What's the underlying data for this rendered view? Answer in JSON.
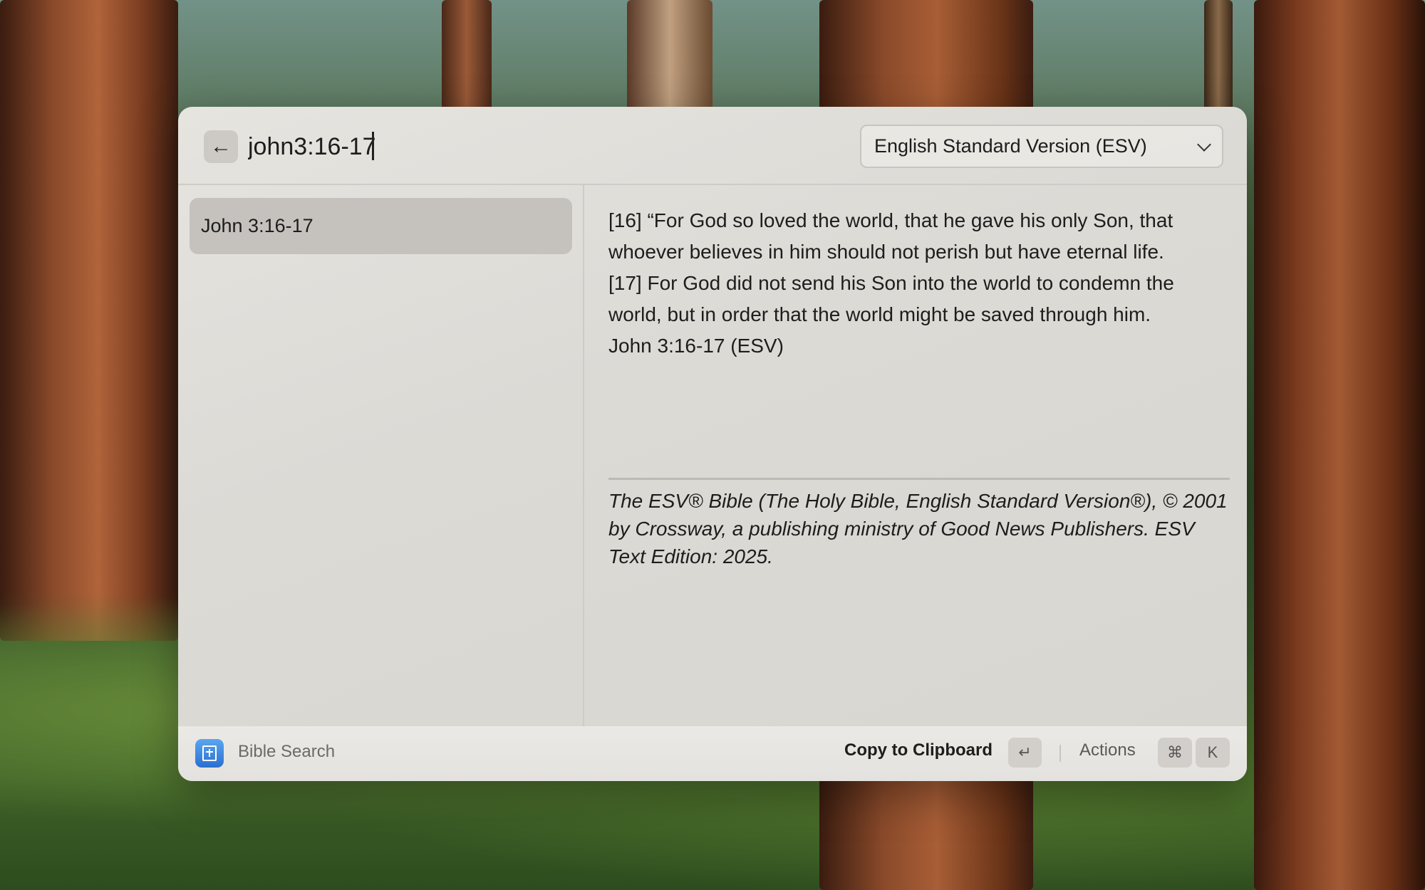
{
  "search": {
    "value": "john3:16-17"
  },
  "version_dropdown": {
    "selected": "English Standard Version (ESV)"
  },
  "results": [
    {
      "label": "John 3:16-17"
    }
  ],
  "detail": {
    "passage_lines": [
      "[16] “For God so loved the world, that he gave his only Son, that",
      "whoever believes in him should not perish but have eternal life.",
      "[17] For God did not send his Son into the world to condemn the",
      "world, but in order that the world might be saved through him.",
      "John 3:16-17 (ESV)"
    ],
    "copyright": "The ESV® Bible (The Holy Bible, English Standard Version®), © 2001 by Crossway, a publishing ministry of Good News Publishers. ESV Text Edition: 2025."
  },
  "footer": {
    "app_name": "Bible Search",
    "primary_action": "Copy to Clipboard",
    "primary_shortcut": "↵",
    "actions_label": "Actions",
    "actions_shortcut_cmd": "⌘",
    "actions_shortcut_key": "K"
  },
  "icons": {
    "back": "arrow-left-icon",
    "dropdown": "chevron-down-icon",
    "app": "bible-book-icon"
  },
  "colors": {
    "app_icon": "#3b88e0",
    "selected_row": "#c5c2bd",
    "window_bg": "#dcdad5"
  }
}
